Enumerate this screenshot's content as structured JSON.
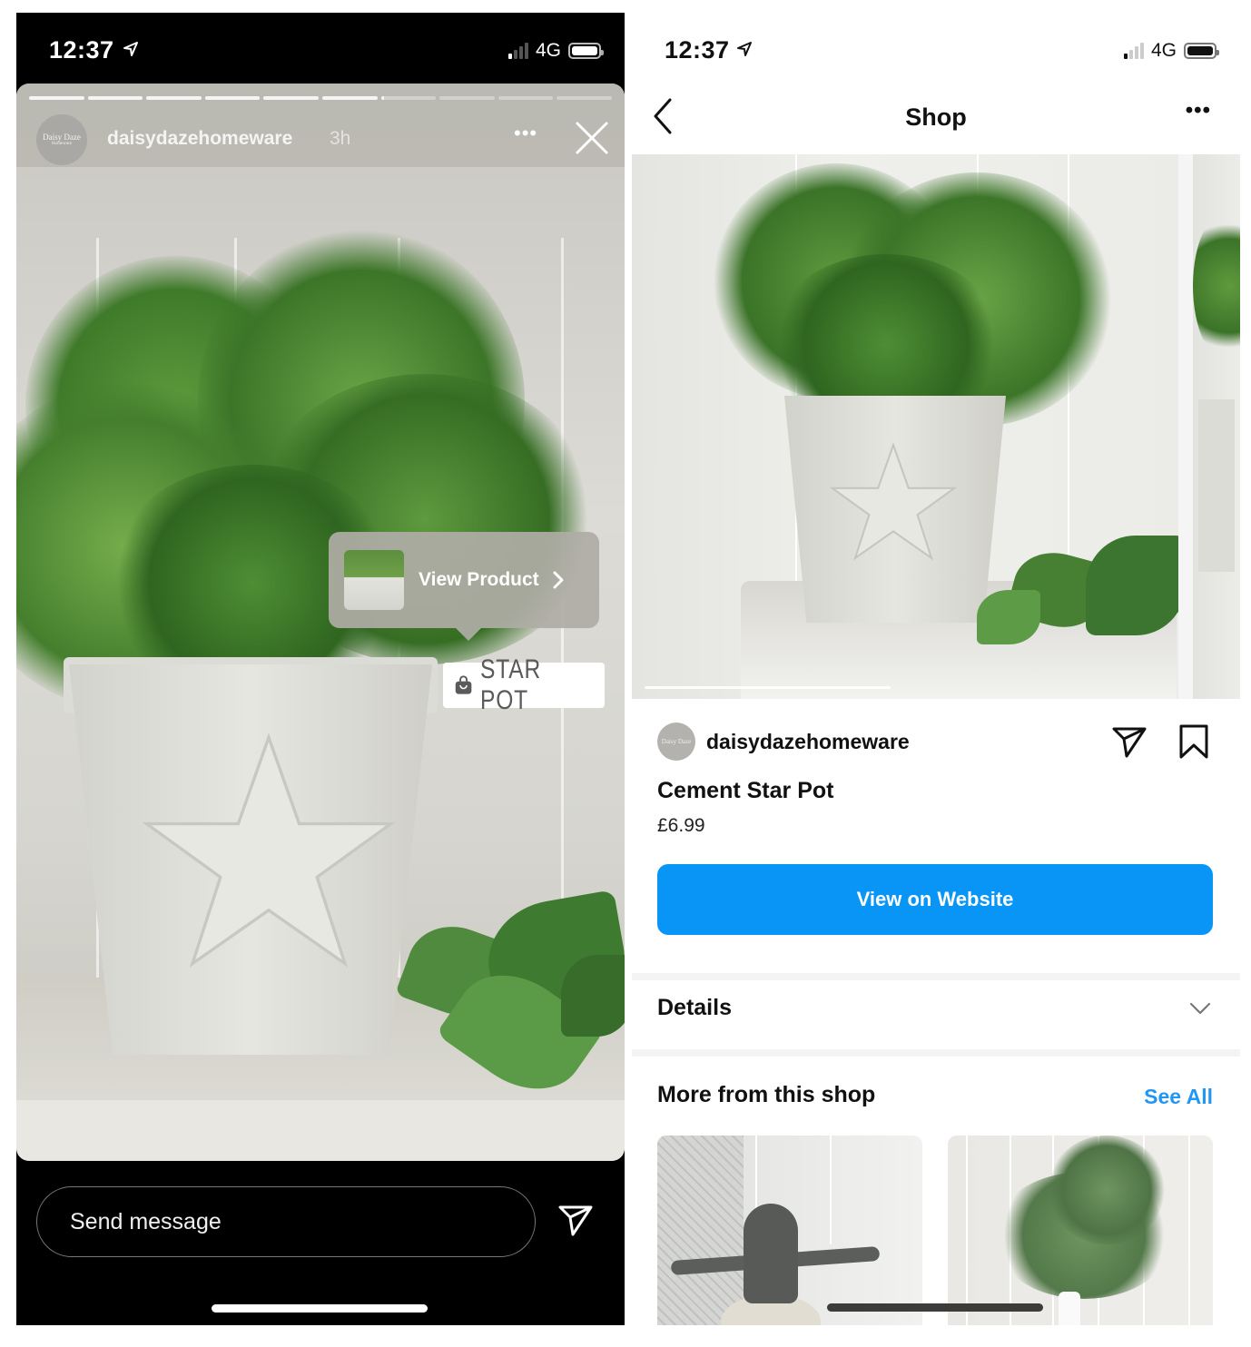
{
  "story_screen": {
    "status_bar": {
      "time": "12:37",
      "network": "4G",
      "signal_bars_active": 1,
      "signal_bars_total": 4
    },
    "progress": {
      "segments_total": 10,
      "segments_complete": 6,
      "current_segment_fraction": 0.05
    },
    "header": {
      "account_name": "daisydazehomeware",
      "avatar_text": "Daisy Daze",
      "avatar_subtext": "Homeware",
      "posted_ago": "3h",
      "more_icon": "more-horizontal-icon",
      "close_icon": "close-icon"
    },
    "product_sticker": {
      "label": "View Product",
      "chevron_icon": "chevron-right-icon"
    },
    "product_tag": {
      "label": "STAR POT",
      "icon": "shopping-bag-icon"
    },
    "footer": {
      "message_placeholder": "Send message",
      "send_icon": "send-icon"
    }
  },
  "shop_screen": {
    "status_bar": {
      "time": "12:37",
      "network": "4G",
      "signal_bars_active": 1,
      "signal_bars_total": 4
    },
    "nav": {
      "title": "Shop",
      "back_icon": "chevron-left-icon",
      "more_icon": "more-horizontal-icon"
    },
    "gallery": {
      "images_visible": 2,
      "progress_fraction": 0.45
    },
    "seller": {
      "name": "daisydazehomeware",
      "avatar_text": "Daisy Daze"
    },
    "product": {
      "name": "Cement Star Pot",
      "price": "£6.99"
    },
    "actions": {
      "share_icon": "send-icon",
      "save_icon": "bookmark-icon"
    },
    "cta_label": "View on Website",
    "details_label": "Details",
    "more_section": {
      "title": "More from this shop",
      "see_all_label": "See All"
    },
    "more_items": [
      {
        "alt": "Frog ornament"
      },
      {
        "alt": "Eucalyptus stems in vase"
      }
    ],
    "colors": {
      "accent_blue": "#0895f6",
      "link_blue": "#2196f3"
    }
  }
}
